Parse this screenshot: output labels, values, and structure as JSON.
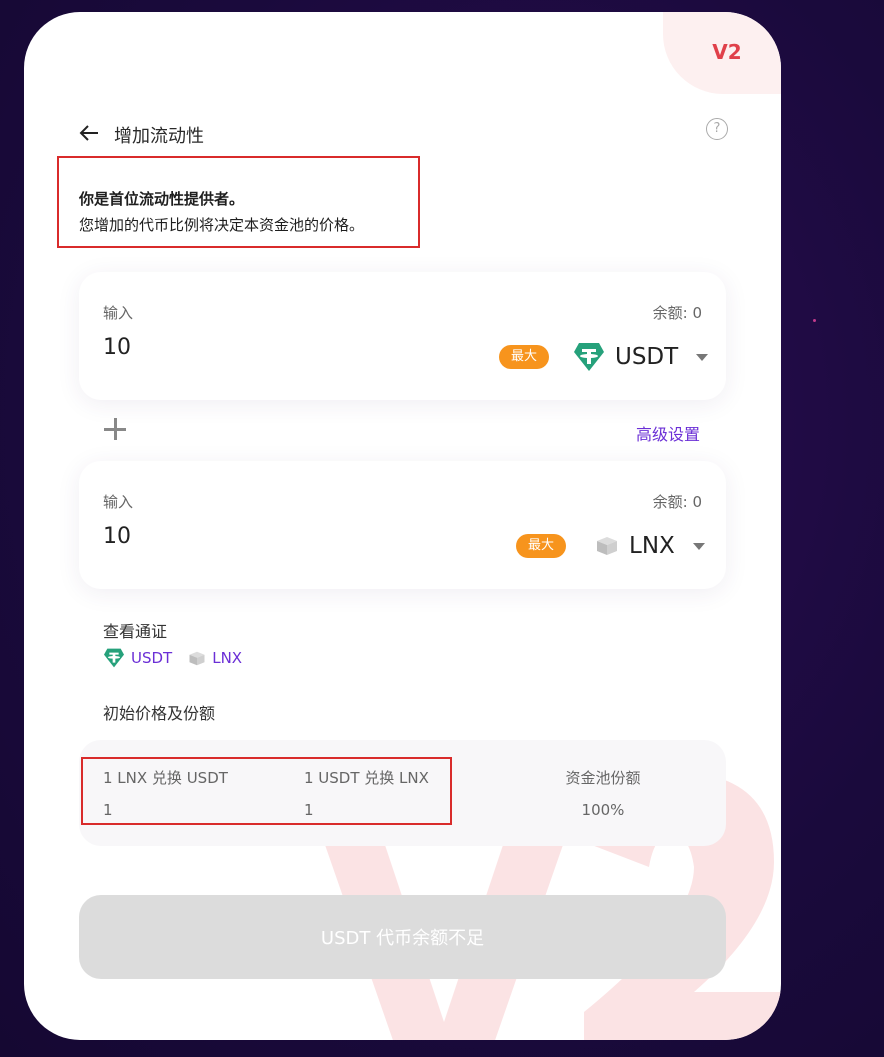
{
  "header": {
    "version": "V2",
    "title": "增加流动性",
    "help": "?"
  },
  "notice": {
    "line1": "你是首位流动性提供者。",
    "line2": "您增加的代币比例将决定本资金池的价格。"
  },
  "input_a": {
    "label": "输入",
    "balance": "余额: 0",
    "value": "10",
    "max": "最大",
    "token": "USDT"
  },
  "advanced": "高级设置",
  "input_b": {
    "label": "输入",
    "balance": "余额: 0",
    "value": "10",
    "max": "最大",
    "token": "LNX"
  },
  "view_token": {
    "label": "查看通证",
    "links": [
      "USDT",
      "LNX"
    ]
  },
  "price": {
    "title": "初始价格及份额",
    "cols": [
      {
        "label": "1 LNX 兑换 USDT",
        "value": "1"
      },
      {
        "label": "1 USDT 兑换 LNX",
        "value": "1"
      },
      {
        "label": "资金池份额",
        "value": "100%"
      }
    ]
  },
  "submit": "USDT 代币余额不足",
  "colors": {
    "accent": "#6b2fd6",
    "max_badge": "#f7941d",
    "tether": "#26a17b",
    "v2": "#e0404a"
  },
  "icons": [
    "back-arrow-icon",
    "help-icon",
    "tether-icon",
    "lnx-cube-icon",
    "chevron-down-icon",
    "plus-icon"
  ]
}
